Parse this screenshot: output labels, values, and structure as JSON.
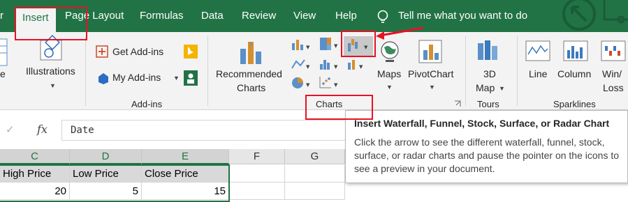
{
  "tabs": {
    "partial": "r",
    "insert": "Insert",
    "page_layout": "Page Layout",
    "formulas": "Formulas",
    "data": "Data",
    "review": "Review",
    "view": "View",
    "help": "Help",
    "tell_me": "Tell me what you want to do"
  },
  "ribbon": {
    "illustrations": "Illustrations",
    "get_addins": "Get Add-ins",
    "my_addins": "My Add-ins",
    "addins_group": "Add-ins",
    "recommended_charts_line1": "Recommended",
    "recommended_charts_line2": "Charts",
    "maps": "Maps",
    "pivotchart": "PivotChart",
    "map3d_line1": "3D",
    "map3d_line2": "Map",
    "charts_group": "Charts",
    "tours_group": "Tours",
    "line": "Line",
    "column": "Column",
    "winloss_line1": "Win/",
    "winloss_line2": "Loss",
    "sparklines_group": "Sparklines"
  },
  "formula_bar": {
    "cancel_glyph": "✓",
    "fx": "fx",
    "value": "Date"
  },
  "columns": [
    "C",
    "D",
    "E",
    "F",
    "G"
  ],
  "row_headers": [
    "High Price",
    "Low Price",
    "Close Price"
  ],
  "row_values": [
    "20",
    "5",
    "15"
  ],
  "tooltip": {
    "title": "Insert Waterfall, Funnel, Stock, Surface, or Radar Chart",
    "body": "Click the arrow to see the different waterfall, funnel, stock, surface, or radar charts and pause the pointer on the icons to see a preview in your document."
  },
  "colors": {
    "ribbon_green": "#217346",
    "annotation_red": "#e81123"
  }
}
